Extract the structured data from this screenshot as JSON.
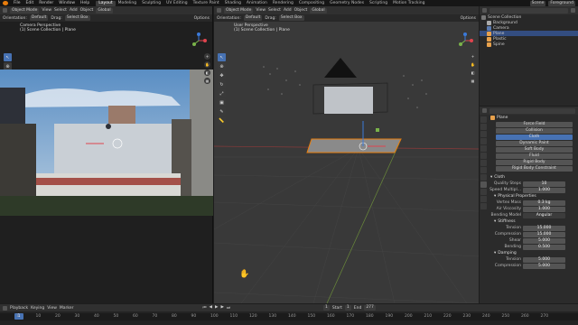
{
  "menubar": {
    "items": [
      "File",
      "Edit",
      "Render",
      "Window",
      "Help"
    ],
    "workspaces": [
      "Layout",
      "Modeling",
      "Sculpting",
      "UV Editing",
      "Texture Paint",
      "Shading",
      "Animation",
      "Rendering",
      "Compositing",
      "Geometry Nodes",
      "Scripting",
      "Motion Tracking"
    ],
    "active_workspace": "Layout",
    "scene": "Scene",
    "view_layer": "Foreground"
  },
  "left_viewport": {
    "mode": "Object Mode",
    "menus": [
      "View",
      "Select",
      "Add",
      "Object"
    ],
    "transform": "Global",
    "orientation_label": "Orientation:",
    "orientation": "Default",
    "drag_label": "Drag:",
    "drag": "Select Box",
    "options": "Options",
    "overlay_title": "Camera Perspective",
    "overlay_sub": "(1) Scene Collection | Plane"
  },
  "right_viewport": {
    "mode": "Object Mode",
    "menus": [
      "View",
      "Select",
      "Add",
      "Object"
    ],
    "transform": "Global",
    "orientation_label": "Orientation:",
    "orientation": "Default",
    "drag_label": "Drag:",
    "drag": "Select Box",
    "options": "Options",
    "overlay_title": "User Perspective",
    "overlay_sub": "(1) Scene Collection | Plane"
  },
  "outliner": {
    "root": "Scene Collection",
    "items": [
      {
        "label": "Background",
        "selected": false
      },
      {
        "label": "Camera",
        "selected": false
      },
      {
        "label": "Plane",
        "selected": true
      },
      {
        "label": "Plastic",
        "selected": false
      },
      {
        "label": "Spine",
        "selected": false
      }
    ]
  },
  "properties": {
    "object_name": "Plane",
    "physics_buttons": [
      "Force Field",
      "Collision",
      "Cloth",
      "Dynamic Paint",
      "Soft Body",
      "Fluid",
      "Rigid Body",
      "Rigid Body Constraint"
    ],
    "cloth_label": "Cloth",
    "quality_label": "Quality Steps",
    "quality_value": "10",
    "speed_label": "Speed Multipl...",
    "speed_value": "1.000",
    "physical_props_label": "Physical Properties",
    "vertex_mass_label": "Vertex Mass",
    "vertex_mass_value": "0.3 kg",
    "air_viscosity_label": "Air Viscosity",
    "air_viscosity_value": "1.000",
    "bending_model_label": "Bending Model",
    "bending_model_value": "Angular",
    "stiffness_label": "Stiffness",
    "tension_label": "Tension",
    "tension_value": "15.000",
    "compression_label": "Compression",
    "compression_value": "15.000",
    "shear_label": "Shear",
    "shear_value": "5.000",
    "bending_label": "Bending",
    "bending_value": "0.500",
    "damping_label": "Damping",
    "d_tension_label": "Tension",
    "d_tension_value": "5.000",
    "d_compression_label": "Compression",
    "d_compression_value": "5.000"
  },
  "timeline": {
    "menus": [
      "Playback",
      "Keying",
      "View",
      "Marker"
    ],
    "current_frame": "1",
    "start_label": "Start",
    "start": "1",
    "end_label": "End",
    "end": "277",
    "ticks": [
      "1",
      "10",
      "20",
      "30",
      "40",
      "50",
      "60",
      "70",
      "80",
      "90",
      "100",
      "110",
      "120",
      "130",
      "140",
      "150",
      "160",
      "170",
      "180",
      "190",
      "200",
      "210",
      "220",
      "230",
      "240",
      "250",
      "260",
      "270"
    ]
  },
  "colors": {
    "accent": "#e87d0d",
    "selection": "#4772b3",
    "axis_x": "#e0444e",
    "axis_y": "#7ab34a",
    "axis_z": "#3b7ad9"
  }
}
